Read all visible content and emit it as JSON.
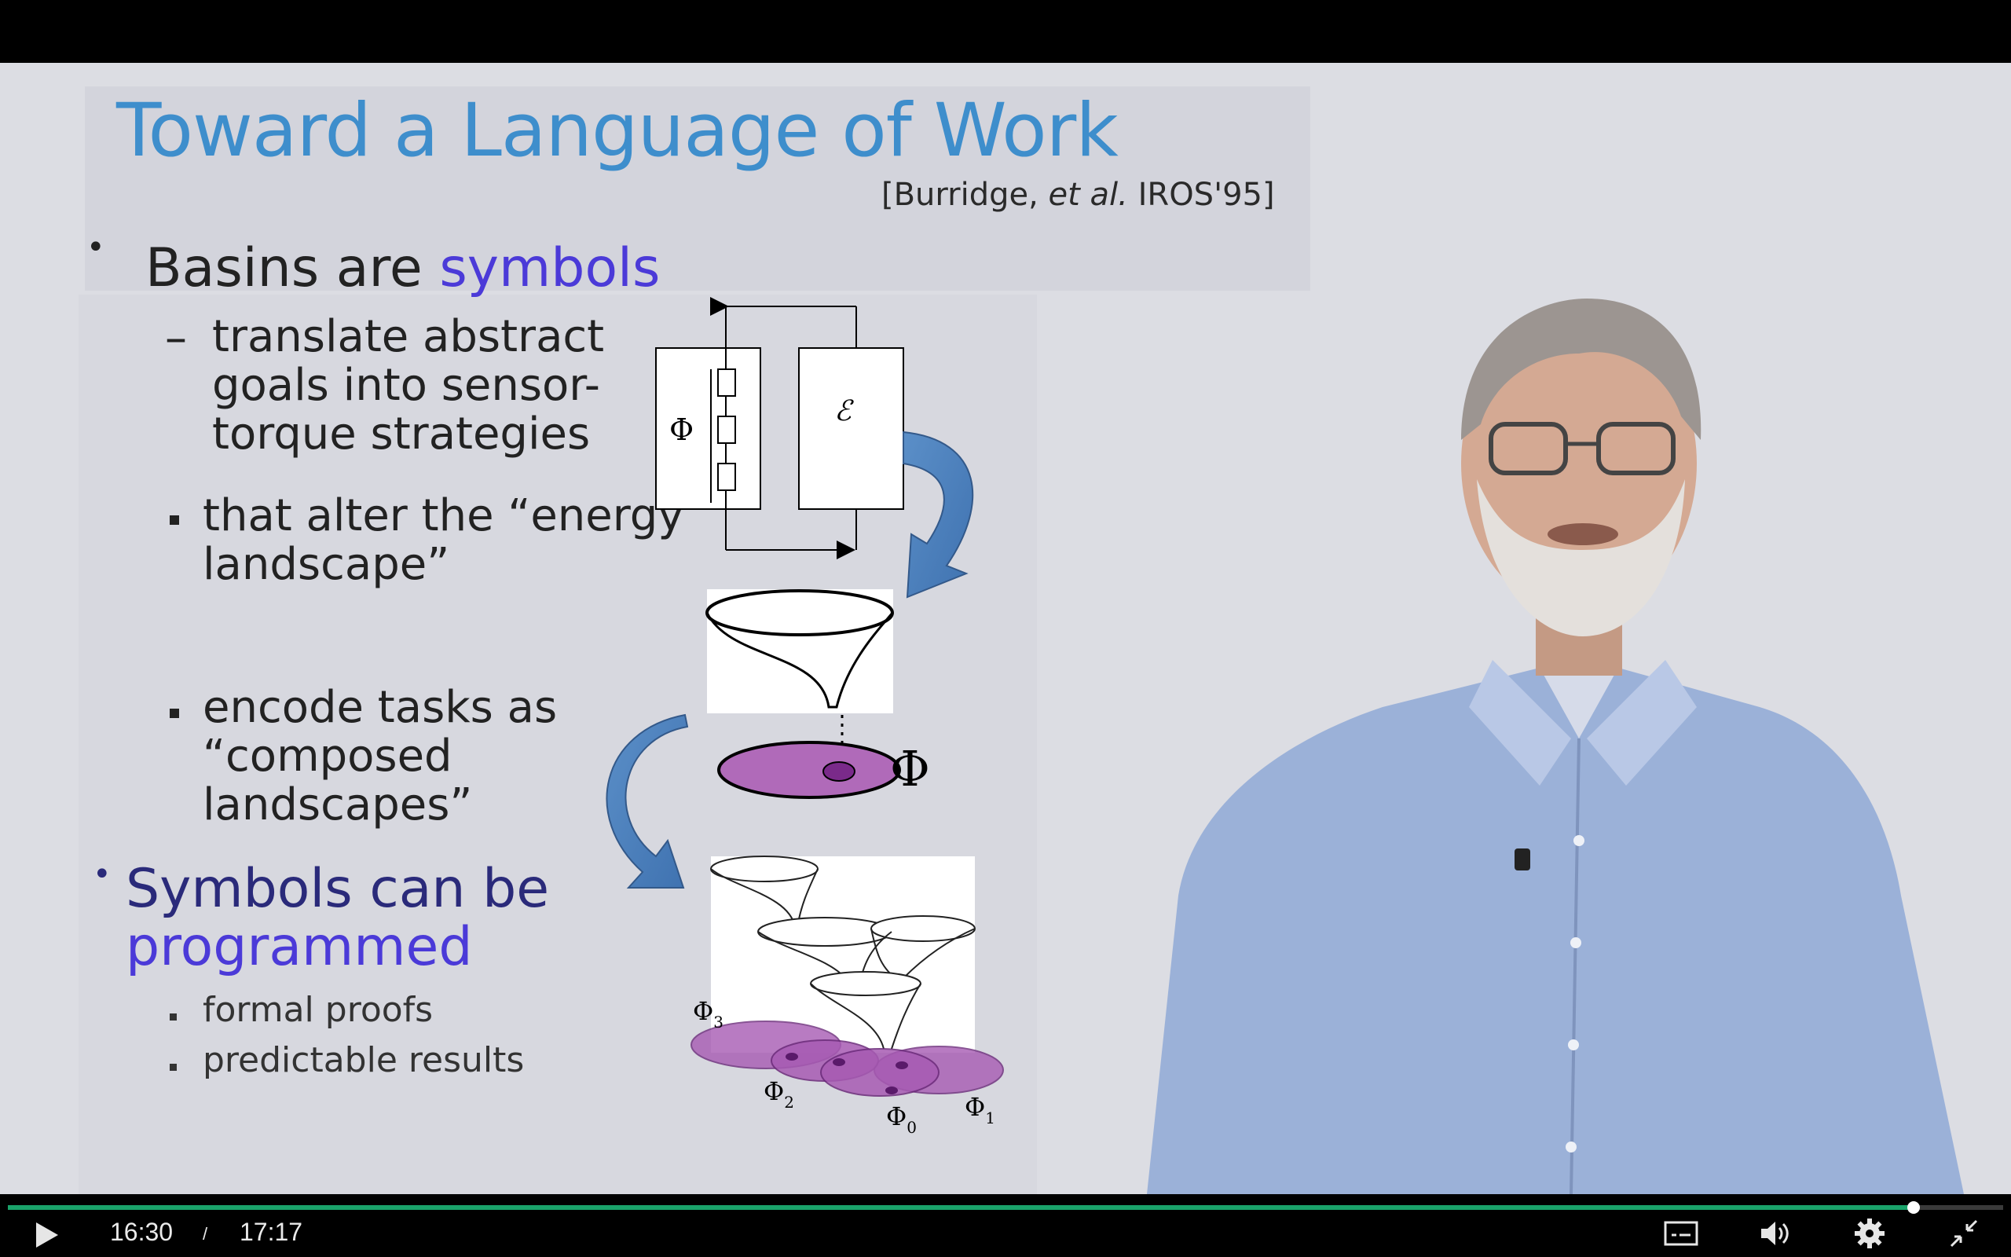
{
  "slide": {
    "title": "Toward a Language of  Work",
    "citation_pre": "[Burridge, ",
    "citation_italic": "et al.",
    "citation_post": " IROS'95]",
    "bullets": {
      "b1_prefix": "Basins are ",
      "b1_highlight": "symbols",
      "b1_sub_dash": "–",
      "b1_sub1_line1": "translate abstract",
      "b1_sub1_line2": "goals into sensor-",
      "b1_sub1_line3": "torque strategies",
      "b1_sub2_line1": "that alter the “energy",
      "b1_sub2_line2": "landscape”",
      "b1_sub3_line1": "encode tasks as",
      "b1_sub3_line2": "“composed",
      "b1_sub3_line3": "landscapes”",
      "b2_line1": "Symbols can be",
      "b2_line2": "programmed",
      "b2_sub1": "formal proofs",
      "b2_sub2": "predictable results"
    },
    "diagram": {
      "phi": "Φ",
      "epsilon": "ℰ",
      "phi_big": "Φ",
      "phi3": "Φ",
      "phi3_sub": "3",
      "phi2": "Φ",
      "phi2_sub": "2",
      "phi0": "Φ",
      "phi0_sub": "0",
      "phi1": "Φ",
      "phi1_sub": "1"
    }
  },
  "player": {
    "current_time": "16:30",
    "separator": "/",
    "duration": "17:17",
    "progress": 0.955,
    "icons": [
      "play-icon",
      "captions-icon",
      "volume-icon",
      "settings-icon",
      "exit-fullscreen-icon"
    ],
    "colors": {
      "progress": "#1aa36a",
      "title": "#3e8ecc",
      "highlight": "#4b3ad8"
    }
  }
}
